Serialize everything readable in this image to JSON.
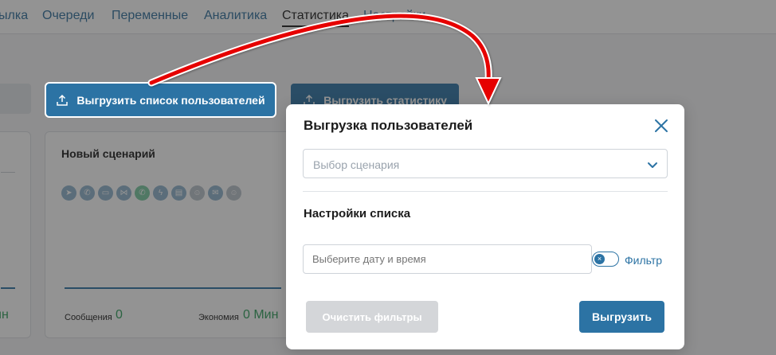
{
  "nav": {
    "items": [
      "ылка",
      "Очереди",
      "Переменные",
      "Аналитика",
      "Статистика",
      "Настройки"
    ],
    "active": "Статистика"
  },
  "toolbar": {
    "export_users_label": "Выгрузить список пользователей",
    "export_stats_label": "Выгрузить статистику"
  },
  "card": {
    "title": "Новый сценарий",
    "messages_label": "Сообщения",
    "messages_value": "0",
    "savings_label": "Экономия",
    "savings_value": "0 Мин",
    "left_value": "ин"
  },
  "modal": {
    "title": "Выгрузка пользователей",
    "scenario_placeholder": "Выбор сценария",
    "section_title": "Настройки списка",
    "date_placeholder": "Выберите дату и время",
    "filter_label": "Фильтр",
    "clear_label": "Очистить фильтры",
    "submit_label": "Выгрузить"
  },
  "colors": {
    "accent": "#2c73a4",
    "arrow": "#e60000",
    "success": "#2e9e5b"
  }
}
